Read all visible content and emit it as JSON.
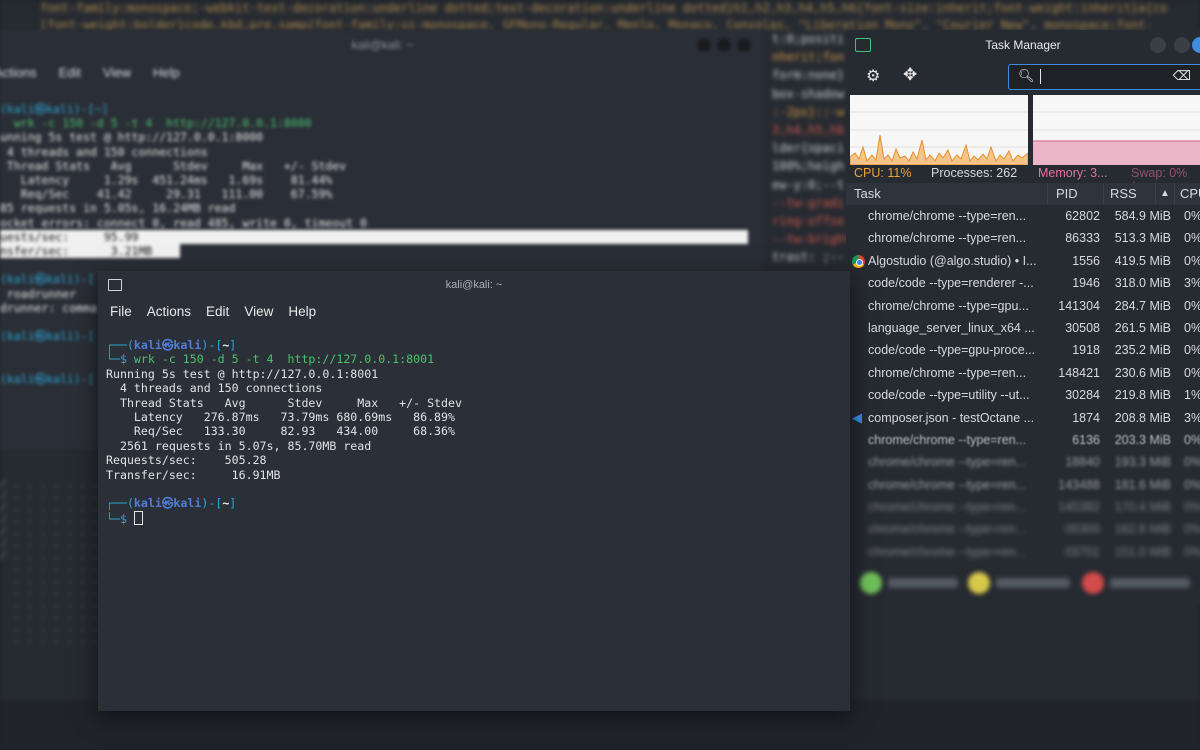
{
  "background_editor": {
    "code_top_1": "font-family:monospace;-webkit-text-decoration:underline dotted;text-decoration:underline dotted}h1,h2,h3,h4,h5,h6{font-size:inherit;font-weight:inherit}a{co",
    "code_top_2": "[font-weight:bolder}code,kbd,pre,samp{font-family:ui-monospace, SFMono-Regular, Menlo, Monaco, Consolas, \"Liberation Mono\", \"Courier New\", monospace;font-",
    "code_right": [
      "t:0;positi",
      "nherit;fon",
      "form:none}",
      "box-shadow",
      ":-2px}::-w",
      "3,h4,h5,h6",
      "lder{opaci",
      "100%;heigh",
      "ew-y:0;--t",
      "--tw-gradi",
      "ring-offse",
      "--tw-bright",
      "trast: ;--"
    ]
  },
  "back_terminal": {
    "title": "kali@kali: ~",
    "menu": [
      "Actions",
      "Edit",
      "View",
      "Help"
    ],
    "lines": [
      "(kali㉿kali)-[~]",
      "  wrk -c 150 -d 5 -t 4  http://127.0.0.1:8000",
      "unning 5s test @ http://127.0.0.1:8000",
      " 4 threads and 150 connections",
      " Thread Stats   Avg      Stdev     Max   +/- Stdev",
      "   Latency     1.29s  451.24ms   1.69s    81.44%",
      "   Req/Sec    41.42     29.31   111.00    67.59%",
      "85 requests in 5.05s, 16.24MB read",
      "ocket errors: connect 0, read 485, write 0, timeout 0"
    ],
    "highlight_1": "uests/sec:     95.99",
    "highlight_2": "nsfer/sec:      3.21MB",
    "after": [
      "(kali㉿kali)-[",
      " roadrunner",
      "drunner: comma",
      "(kali㉿kali)-[",
      "(kali㉿kali)-["
    ]
  },
  "front_terminal": {
    "title": "kali@kali: ~",
    "menu": [
      "File",
      "Actions",
      "Edit",
      "View",
      "Help"
    ],
    "prompt_user": "kali㉿kali",
    "prompt_dir": "~",
    "command": "wrk -c 150 -d 5 -t 4  http://127.0.0.1:8001",
    "output": [
      "Running 5s test @ http://127.0.0.1:8001",
      "  4 threads and 150 connections",
      "  Thread Stats   Avg      Stdev     Max   +/- Stdev",
      "    Latency   276.87ms   73.79ms 680.69ms   86.89%",
      "    Req/Sec   133.30     82.93   434.00     68.36%",
      "  2561 requests in 5.07s, 85.70MB read",
      "Requests/sec:    505.28",
      "Transfer/sec:     16.91MB"
    ]
  },
  "task_manager": {
    "title": "Task Manager",
    "search_value": "",
    "cpu_label": "CPU: 11%",
    "processes_label": "Processes: 262",
    "memory_label": "Memory: 3...",
    "swap_label": "Swap: 0% (...",
    "columns": {
      "task": "Task",
      "pid": "PID",
      "rss": "RSS",
      "cpu": "CPU"
    },
    "sort_indicator": "▲",
    "colors": {
      "cpu": "#f3a13a",
      "memory": "#e0759a",
      "accent": "#3f8be0"
    },
    "rows": [
      {
        "task": "chrome/chrome --type=ren...",
        "pid": "62802",
        "rss": "584.9 MiB",
        "cpu": "0%",
        "icon": ""
      },
      {
        "task": "chrome/chrome --type=ren...",
        "pid": "86333",
        "rss": "513.3 MiB",
        "cpu": "0%",
        "icon": ""
      },
      {
        "task": "Algostudio (@algo.studio) • I...",
        "pid": "1556",
        "rss": "419.5 MiB",
        "cpu": "0%",
        "icon": "chrome-icon"
      },
      {
        "task": "code/code --type=renderer -...",
        "pid": "1946",
        "rss": "318.0 MiB",
        "cpu": "3%",
        "icon": ""
      },
      {
        "task": "chrome/chrome --type=gpu...",
        "pid": "141304",
        "rss": "284.7 MiB",
        "cpu": "0%",
        "icon": ""
      },
      {
        "task": "language_server_linux_x64 ...",
        "pid": "30508",
        "rss": "261.5 MiB",
        "cpu": "0%",
        "icon": ""
      },
      {
        "task": "code/code --type=gpu-proce...",
        "pid": "1918",
        "rss": "235.2 MiB",
        "cpu": "0%",
        "icon": ""
      },
      {
        "task": "chrome/chrome --type=ren...",
        "pid": "148421",
        "rss": "230.6 MiB",
        "cpu": "0%",
        "icon": ""
      },
      {
        "task": "code/code --type=utility --ut...",
        "pid": "30284",
        "rss": "219.8 MiB",
        "cpu": "1%",
        "icon": ""
      },
      {
        "task": "composer.json - testOctane ...",
        "pid": "1874",
        "rss": "208.8 MiB",
        "cpu": "3%",
        "icon": "vscode-icon"
      },
      {
        "task": "chrome/chrome --type=ren...",
        "pid": "6136",
        "rss": "203.3 MiB",
        "cpu": "0%",
        "icon": ""
      },
      {
        "task": "chrome/chrome --type=ren...",
        "pid": "18840",
        "rss": "193.3 MiB",
        "cpu": "0%",
        "icon": ""
      },
      {
        "task": "chrome/chrome --type=ren...",
        "pid": "143488",
        "rss": "181.6 MiB",
        "cpu": "0%",
        "icon": ""
      },
      {
        "task": "chrome/chrome --type=ren...",
        "pid": "145382",
        "rss": "170.4 MiB",
        "cpu": "0%",
        "icon": ""
      },
      {
        "task": "chrome/chrome --type=ren...",
        "pid": "00300",
        "rss": "162.8 MiB",
        "cpu": "0%",
        "icon": ""
      },
      {
        "task": "chrome/chrome --type=ren...",
        "pid": "03701",
        "rss": "151.0 MiB",
        "cpu": "0%",
        "icon": ""
      }
    ]
  }
}
